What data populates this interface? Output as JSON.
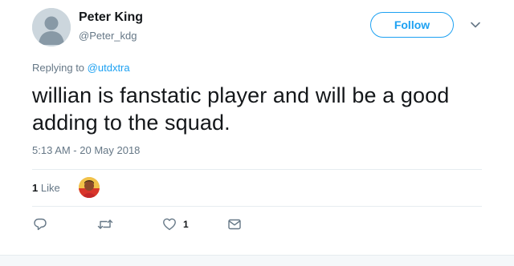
{
  "author": {
    "name": "Peter King",
    "handle": "@Peter_kdg"
  },
  "follow_button": {
    "label": "Follow"
  },
  "reply": {
    "prefix": "Replying to",
    "mention": "@utdxtra"
  },
  "tweet": {
    "text": "willian is fanstatic player and will be a good adding to the squad.",
    "timestamp": "5:13 AM - 20 May 2018"
  },
  "stats": {
    "likes_number": "1",
    "likes_label": "Like"
  },
  "actions": {
    "like_count": "1"
  },
  "colors": {
    "accent": "#1da1f2",
    "secondary_text": "#657786",
    "primary_text": "#14171a",
    "divider": "#e6ecf0"
  },
  "icons": [
    "default-avatar-icon",
    "chevron-down-icon",
    "reply-icon",
    "retweet-icon",
    "heart-icon",
    "direct-message-icon"
  ]
}
